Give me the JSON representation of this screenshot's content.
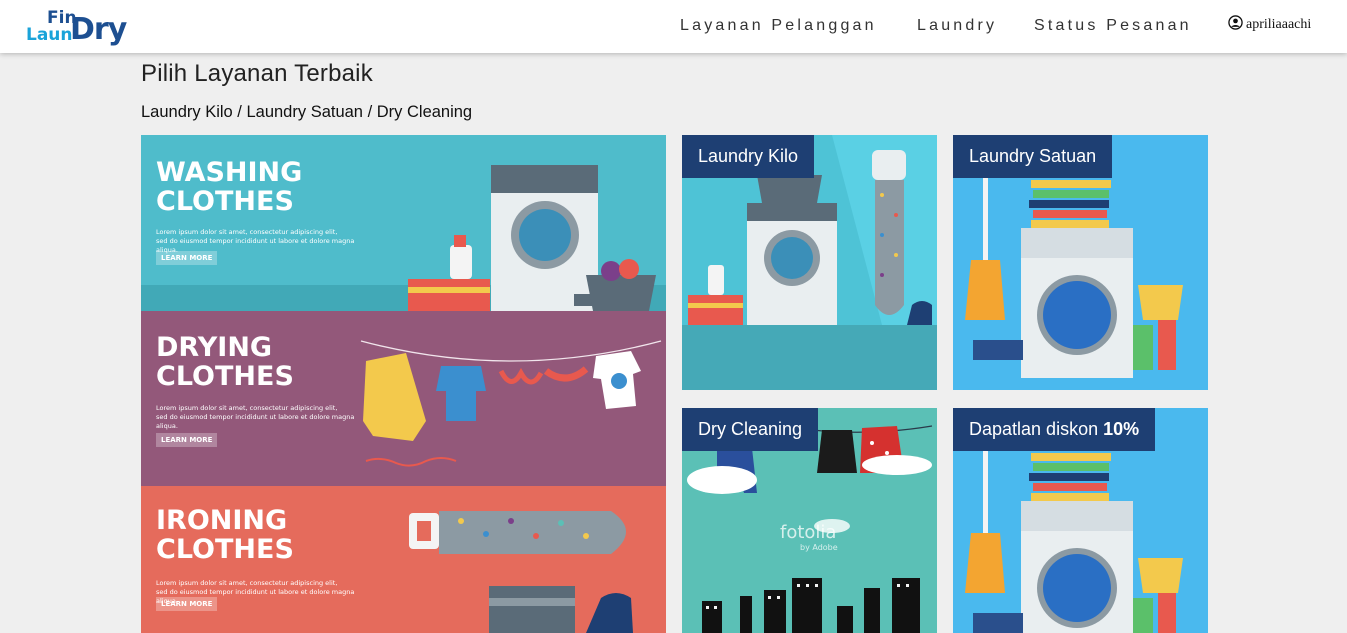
{
  "brand": {
    "fin": "Fin",
    "laun": "Laun",
    "dry": "Dry"
  },
  "nav": {
    "items": [
      "Layanan Pelanggan",
      "Laundry",
      "Status Pesanan"
    ],
    "user": "apriliaaachi"
  },
  "page": {
    "title": "Pilih Layanan Terbaik",
    "subtitle": "Laundry Kilo / Laundry Satuan / Dry Cleaning"
  },
  "banner": {
    "sections": [
      {
        "title1": "WASHING",
        "title2": "CLOTHES",
        "text1": "Lorem ipsum dolor sit amet, consectetur adipiscing elit,",
        "text2": "sed do eiusmod tempor incididunt ut labore et dolore magna aliqua.",
        "button": "LEARN MORE"
      },
      {
        "title1": "DRYING",
        "title2": "CLOTHES",
        "text1": "Lorem ipsum dolor sit amet, consectetur adipiscing elit,",
        "text2": "sed do eiusmod tempor incididunt ut labore et dolore magna aliqua.",
        "button": "LEARN MORE"
      },
      {
        "title1": "IRONING",
        "title2": "CLOTHES",
        "text1": "Lorem ipsum dolor sit amet, consectetur adipiscing elit,",
        "text2": "sed do eiusmod tempor incididunt ut labore et dolore magna aliqua.",
        "button": "LEARN MORE"
      }
    ]
  },
  "cards": [
    {
      "label": "Laundry Kilo"
    },
    {
      "label": "Laundry Satuan"
    },
    {
      "label": "Dry Cleaning",
      "watermark": "fotolia",
      "watermark_sub": "by Adobe"
    },
    {
      "label_prefix": "Dapatlan diskon",
      "label_bold": "10%"
    }
  ],
  "colors": {
    "label_bg": "#1e3f73",
    "wash_band": "#4fbccb",
    "dry_band": "#93587a",
    "iron_band": "#e56b5c"
  },
  "icons": [
    "user-circle-icon"
  ]
}
